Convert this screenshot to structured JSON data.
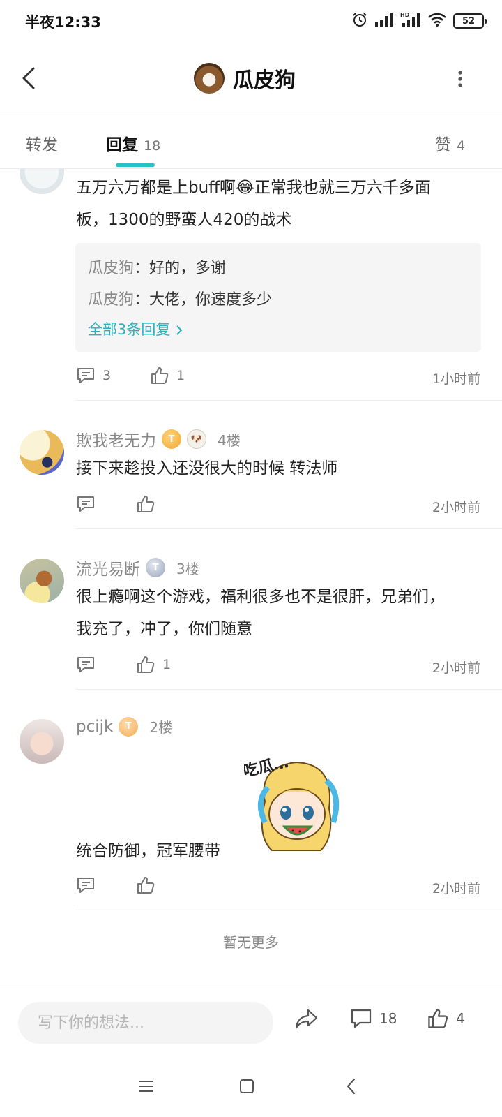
{
  "status_bar": {
    "time": "半夜12:33",
    "battery": "52"
  },
  "header": {
    "title": "瓜皮狗"
  },
  "tabs": [
    {
      "label": "转发",
      "count": ""
    },
    {
      "label": "回复",
      "count": "18"
    },
    {
      "label": "赞",
      "count": "4"
    }
  ],
  "comments": [
    {
      "text_lines": [
        "五万六万都是上buff啊😂正常我也就三万六千多面",
        "板，1300的野蛮人420的战术"
      ],
      "replies": [
        {
          "author": "瓜皮狗",
          "text": "好的，多谢"
        },
        {
          "author": "瓜皮狗",
          "text": "大佬，你速度多少"
        }
      ],
      "more_replies": "全部3条回复",
      "reply_count": "3",
      "like_count": "1",
      "time": "1小时前"
    },
    {
      "author": "欺我老无力",
      "floor": "4楼",
      "text_lines": [
        "接下来趁投入还没很大的时候  转法师"
      ],
      "reply_count": "",
      "like_count": "",
      "time": "2小时前"
    },
    {
      "author": "流光易断",
      "floor": "3楼",
      "text_lines": [
        "很上瘾啊这个游戏，福利很多也不是很肝，兄弟们，",
        "我充了，冲了，你们随意"
      ],
      "reply_count": "",
      "like_count": "1",
      "time": "2小时前"
    },
    {
      "author": "pcijk",
      "floor": "2楼",
      "sticker_text": "吃瓜…",
      "text_lines": [
        "统合防御，冠军腰带"
      ],
      "reply_count": "",
      "like_count": "",
      "time": "2小时前"
    }
  ],
  "no_more": "暂无更多",
  "bottom_bar": {
    "input_placeholder": "写下你的想法...",
    "comment_count": "18",
    "like_count": "4"
  },
  "colors": {
    "accent": "#2bbfc6",
    "link": "#27b3bd"
  }
}
